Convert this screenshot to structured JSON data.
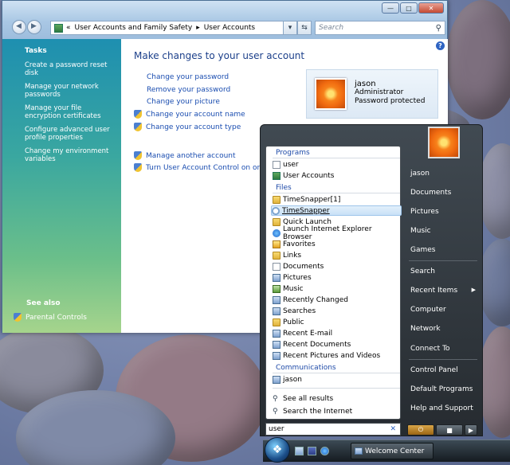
{
  "colors": {
    "accent": "#1a4db0",
    "panel_top": "#1e8fb0",
    "panel_bottom": "#a6d48c",
    "menu_dark": "#262b30"
  },
  "cp": {
    "breadcrumb": [
      "User Accounts and Family Safety",
      "User Accounts"
    ],
    "search_placeholder": "Search",
    "tasks_title": "Tasks",
    "tasks": [
      "Create a password reset disk",
      "Manage your network passwords",
      "Manage your file encryption certificates",
      "Configure advanced user profile properties",
      "Change my environment variables"
    ],
    "see_also": "See also",
    "parental_controls": "Parental Controls",
    "heading": "Make changes to your user account",
    "links": [
      "Change your password",
      "Remove your password",
      "Change your picture",
      "Change your account name",
      "Change your account type",
      "Manage another account",
      "Turn User Account Control on or off"
    ],
    "user": {
      "name": "jason",
      "role": "Administrator",
      "status": "Password protected"
    }
  },
  "start": {
    "groups": {
      "programs": "Programs",
      "files": "Files",
      "communications": "Communications"
    },
    "programs": [
      "user",
      "User Accounts"
    ],
    "files": [
      "TimeSnapper[1]",
      "TimeSnapper",
      "Quick Launch",
      "Launch Internet Explorer Browser",
      "Favorites",
      "Links",
      "Documents",
      "Pictures",
      "Music",
      "Recently Changed",
      "Searches",
      "Public",
      "Recent E-mail",
      "Recent Documents",
      "Recent Pictures and Videos"
    ],
    "communications": [
      "jason"
    ],
    "see_all": "See all results",
    "search_internet": "Search the Internet",
    "search_value": "user",
    "right": [
      "jason",
      "Documents",
      "Pictures",
      "Music",
      "Games",
      "Search",
      "Recent Items",
      "Computer",
      "Network",
      "Connect To",
      "Control Panel",
      "Default Programs",
      "Help and Support"
    ]
  },
  "taskbar": {
    "window_label": "Welcome Center"
  }
}
